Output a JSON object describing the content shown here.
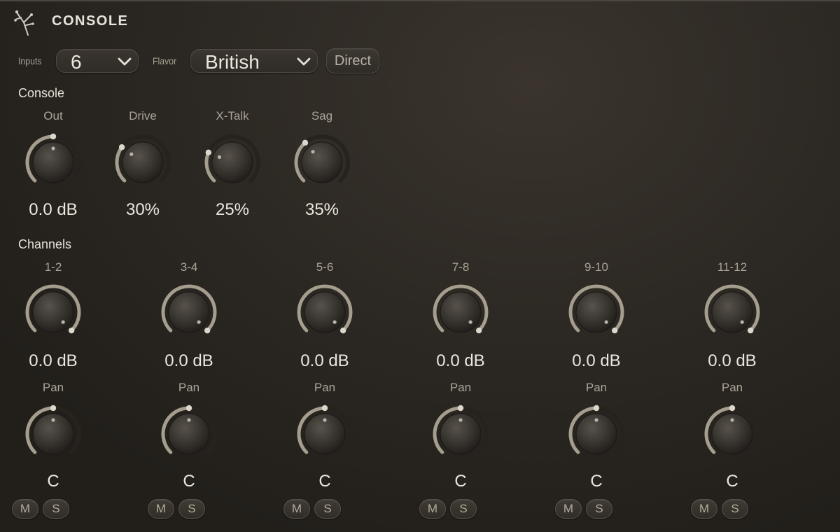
{
  "header": {
    "title": "CONSOLE",
    "logo_icon": "branch-logo-icon"
  },
  "controls": {
    "inputs_label": "Inputs",
    "inputs_value": "6",
    "flavor_label": "Flavor",
    "flavor_value": "British",
    "direct_label": "Direct"
  },
  "console_section": {
    "title": "Console",
    "knobs": [
      {
        "label": "Out",
        "value": "0.0 dB",
        "level": 0.5
      },
      {
        "label": "Drive",
        "value": "30%",
        "level": 0.3
      },
      {
        "label": "X-Talk",
        "value": "25%",
        "level": 0.25
      },
      {
        "label": "Sag",
        "value": "35%",
        "level": 0.35
      }
    ]
  },
  "channels_section": {
    "title": "Channels",
    "channels": [
      {
        "label": "1-2",
        "value": "0.0 dB",
        "level": 1.0,
        "pan_label": "Pan",
        "pan_value": "C",
        "pan_level": 0.5,
        "mute": "M",
        "solo": "S"
      },
      {
        "label": "3-4",
        "value": "0.0 dB",
        "level": 1.0,
        "pan_label": "Pan",
        "pan_value": "C",
        "pan_level": 0.5,
        "mute": "M",
        "solo": "S"
      },
      {
        "label": "5-6",
        "value": "0.0 dB",
        "level": 1.0,
        "pan_label": "Pan",
        "pan_value": "C",
        "pan_level": 0.5,
        "mute": "M",
        "solo": "S"
      },
      {
        "label": "7-8",
        "value": "0.0 dB",
        "level": 1.0,
        "pan_label": "Pan",
        "pan_value": "C",
        "pan_level": 0.5,
        "mute": "M",
        "solo": "S"
      },
      {
        "label": "9-10",
        "value": "0.0 dB",
        "level": 1.0,
        "pan_label": "Pan",
        "pan_value": "C",
        "pan_level": 0.5,
        "mute": "M",
        "solo": "S"
      },
      {
        "label": "11-12",
        "value": "0.0 dB",
        "level": 1.0,
        "pan_label": "Pan",
        "pan_value": "C",
        "pan_level": 0.5,
        "mute": "M",
        "solo": "S"
      }
    ]
  },
  "colors": {
    "arc": "#a59e8f",
    "track": "#26221e",
    "text": "#ece7dd",
    "muted_text": "#aaa397"
  }
}
